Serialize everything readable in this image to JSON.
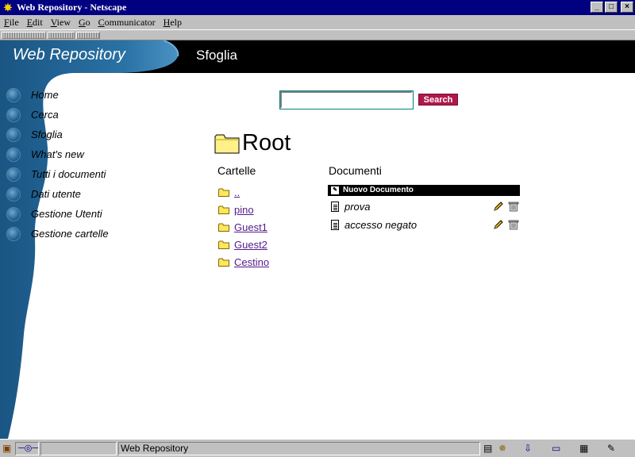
{
  "window": {
    "title": "Web Repository - Netscape",
    "controls": {
      "minimize": "_",
      "maximize": "□",
      "close": "×"
    }
  },
  "menubar": {
    "items": [
      "File",
      "Edit",
      "View",
      "Go",
      "Communicator",
      "Help"
    ]
  },
  "header": {
    "brand": "Web Repository",
    "section_title": "Sfoglia"
  },
  "nav": {
    "items": [
      "Home",
      "Cerca",
      "Sfoglia",
      "What's new",
      "Tutti i documenti",
      "Dati utente",
      "Gestione Utenti",
      "Gestione cartelle"
    ]
  },
  "search": {
    "value": "",
    "button_label": "Search"
  },
  "root": {
    "title": "Root"
  },
  "folders": {
    "heading": "Cartelle",
    "items": [
      "..",
      "pino",
      "Guest1",
      "Guest2",
      "Cestino"
    ]
  },
  "documents": {
    "heading": "Documenti",
    "new_label": "Nuovo Documento",
    "items": [
      "prova",
      "accesso negato"
    ]
  },
  "statusbar": {
    "text": "Web Repository"
  },
  "colors": {
    "title_bar": "#000080",
    "header_bar": "#000000",
    "wave_blue": "#1e5f8e",
    "search_button": "#b0184a",
    "visited_link": "#551a8b"
  }
}
